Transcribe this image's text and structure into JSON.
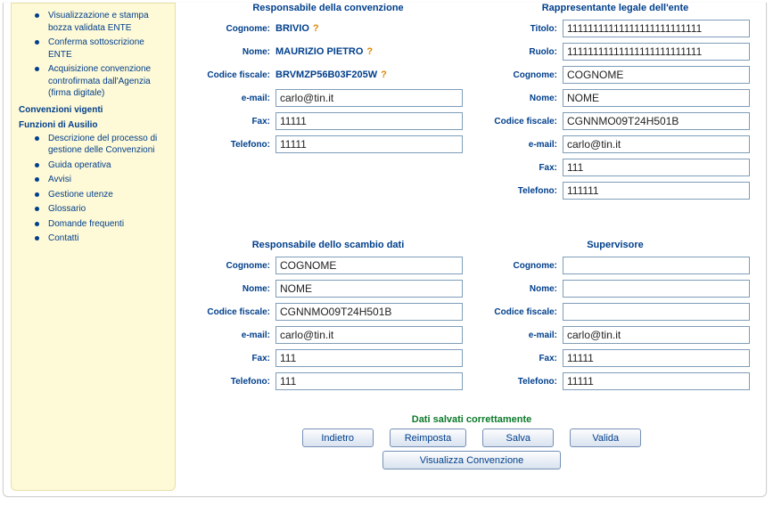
{
  "sidebar": {
    "items_top": [
      "Visualizzazione e stampa bozza validata ENTE",
      "Conferma sottoscrizione ENTE",
      "Acquisizione convenzione controfirmata dall'Agenzia (firma digitale)"
    ],
    "heading1": "Convenzioni vigenti",
    "heading2": "Funzioni di Ausilio",
    "items_bottom": [
      "Descrizione del processo di gestione delle Convenzioni",
      "Guida operativa",
      "Avvisi",
      "Gestione utenze",
      "Glossario",
      "Domande frequenti",
      "Contatti"
    ]
  },
  "labels": {
    "cognome": "Cognome:",
    "nome": "Nome:",
    "codice_fiscale": "Codice fiscale:",
    "email": "e-mail:",
    "fax": "Fax:",
    "telefono": "Telefono:",
    "titolo": "Titolo:",
    "ruolo": "Ruolo:"
  },
  "sections": {
    "responsabile_convenzione": {
      "title": "Responsabile della convenzione",
      "cognome": "BRIVIO",
      "nome": "MAURIZIO PIETRO",
      "codice_fiscale": "BRVMZP56B03F205W",
      "email": "carlo@tin.it",
      "fax": "11111",
      "telefono": "11111"
    },
    "rappresentante_legale": {
      "title": "Rappresentante legale dell'ente",
      "titolo": "11111111111111111111111111",
      "ruolo": "11111111111111111111111111",
      "cognome": "COGNOME",
      "nome": "NOME",
      "codice_fiscale": "CGNNMO09T24H501B",
      "email": "carlo@tin.it",
      "fax": "111",
      "telefono": "111111"
    },
    "responsabile_scambio": {
      "title": "Responsabile dello scambio dati",
      "cognome": "COGNOME",
      "nome": "NOME",
      "codice_fiscale": "CGNNMO09T24H501B",
      "email": "carlo@tin.it",
      "fax": "111",
      "telefono": "111"
    },
    "supervisore": {
      "title": "Supervisore",
      "cognome": "",
      "nome": "",
      "codice_fiscale": "",
      "email": "carlo@tin.it",
      "fax": "11111",
      "telefono": "11111"
    }
  },
  "status": "Dati salvati correttamente",
  "buttons": {
    "indietro": "Indietro",
    "reimposta": "Reimposta",
    "salva": "Salva",
    "valida": "Valida",
    "visualizza": "Visualizza Convenzione"
  },
  "warning_mark": "?"
}
